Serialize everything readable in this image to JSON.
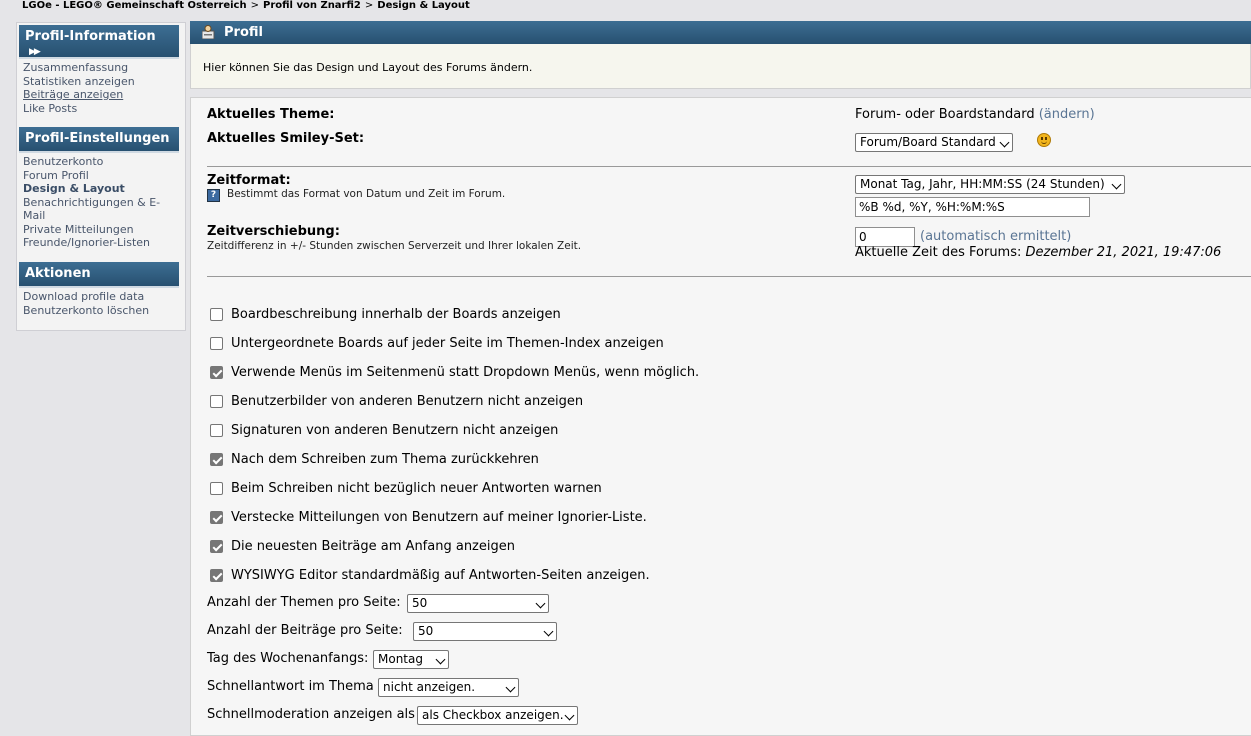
{
  "breadcrumb": [
    "LGOe - LEGO® Gemeinschaft Österreich",
    "Profil von Znarfi2",
    "Design & Layout"
  ],
  "sidebar": {
    "sections": [
      {
        "title": "Profil-Information",
        "items": [
          "Zusammenfassung",
          "Statistiken anzeigen",
          "Beiträge anzeigen",
          "Like Posts"
        ]
      },
      {
        "title": "Profil-Einstellungen",
        "items": [
          "Benutzerkonto",
          "Forum Profil",
          "Design & Layout",
          "Benachrichtigungen & E-",
          "Mail",
          "Private Mitteilungen",
          "Freunde/Ignorier-Listen"
        ]
      },
      {
        "title": "Aktionen",
        "items": [
          "Download profile data",
          "Benutzerkonto löschen"
        ]
      }
    ]
  },
  "panel": {
    "title": "Profil",
    "description": "Hier können Sie das Design und Layout des Forums ändern."
  },
  "theme": {
    "label": "Aktuelles Theme:",
    "value": "Forum- oder Boardstandard",
    "change_link": "(ändern)"
  },
  "smiley": {
    "label": "Aktuelles Smiley-Set:",
    "selected": "Forum/Board Standard"
  },
  "timeformat": {
    "label": "Zeitformat:",
    "help": "Bestimmt das Format von Datum und Zeit im Forum.",
    "selected": "Monat Tag, Jahr, HH:MM:SS (24 Stunden)",
    "value": "%B %d, %Y, %H:%M:%S"
  },
  "timeoffset": {
    "label": "Zeitverschiebung:",
    "help": "Zeitdifferenz in +/- Stunden zwischen Serverzeit und Ihrer lokalen Zeit.",
    "value": "0",
    "auto_link": "(automatisch ermittelt)",
    "current_label": "Aktuelle Zeit des Forums:",
    "current_value": "Dezember 21, 2021, 19:47:06"
  },
  "checkboxes": [
    {
      "label": "Boardbeschreibung innerhalb der Boards anzeigen",
      "checked": false
    },
    {
      "label": "Untergeordnete Boards auf jeder Seite im Themen-Index anzeigen",
      "checked": false
    },
    {
      "label": "Verwende Menüs im Seitenmenü statt Dropdown Menüs, wenn möglich.",
      "checked": true
    },
    {
      "label": "Benutzerbilder von anderen Benutzern nicht anzeigen",
      "checked": false
    },
    {
      "label": "Signaturen von anderen Benutzern nicht anzeigen",
      "checked": false
    },
    {
      "label": "Nach dem Schreiben zum Thema zurückkehren",
      "checked": true
    },
    {
      "label": "Beim Schreiben nicht bezüglich neuer Antworten warnen",
      "checked": false
    },
    {
      "label": "Verstecke Mitteilungen von Benutzern auf meiner Ignorier-Liste.",
      "checked": true
    },
    {
      "label": "Die neuesten Beiträge am Anfang anzeigen",
      "checked": true
    },
    {
      "label": "WYSIWYG Editor standardmäßig auf Antworten-Seiten anzeigen.",
      "checked": true
    }
  ],
  "options": [
    {
      "label": "Anzahl der Themen pro Seite:",
      "selected": "50"
    },
    {
      "label": "Anzahl der Beiträge pro Seite:",
      "selected": "50"
    },
    {
      "label": "Tag des Wochenanfangs:",
      "selected": "Montag"
    },
    {
      "label": "Schnellantwort im Thema",
      "selected": "nicht anzeigen."
    },
    {
      "label": "Schnellmoderation anzeigen als",
      "selected": "als Checkbox anzeigen."
    }
  ],
  "icons": [
    "profile-icon",
    "help-icon",
    "smiley-icon",
    "double-arrow-icon"
  ]
}
